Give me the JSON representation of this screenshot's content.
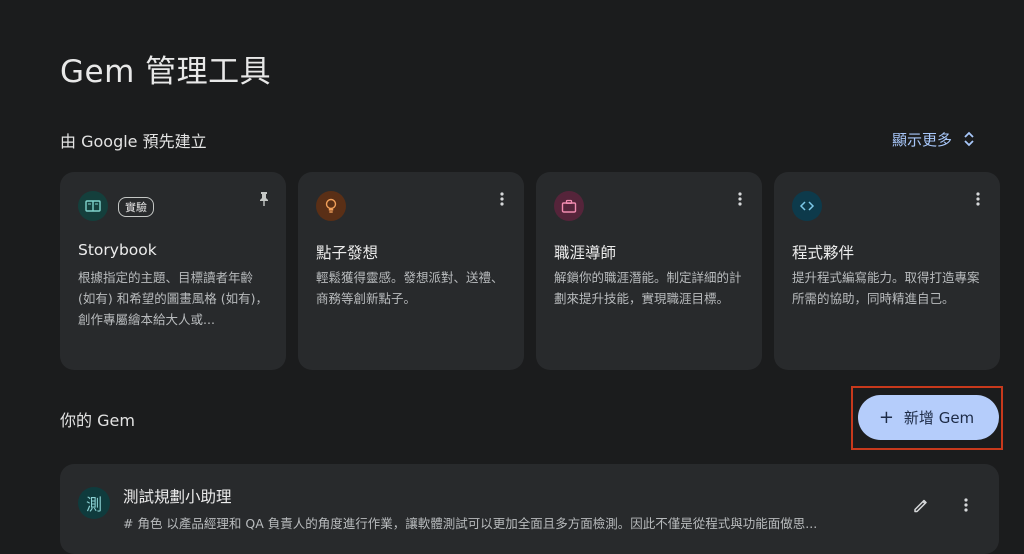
{
  "page": {
    "title": "Gem 管理工具"
  },
  "premade": {
    "title": "由 Google 預先建立",
    "show_more": "顯示更多",
    "cards": [
      {
        "title": "Storybook",
        "badge": "實驗",
        "description": "根據指定的主題、目標讀者年齡 (如有) 和希望的圖畫風格 (如有)，創作專屬繪本給大人或...",
        "icon": "book-icon",
        "corner_icon": "pin-icon",
        "color": "#143f3c"
      },
      {
        "title": "點子發想",
        "description": "輕鬆獲得靈感。發想派對、送禮、商務等創新點子。",
        "icon": "lightbulb-icon",
        "corner_icon": "more-vert-icon",
        "color": "#5a2f16"
      },
      {
        "title": "職涯導師",
        "description": "解鎖你的職涯潛能。制定詳細的計劃來提升技能，實現職涯目標。",
        "icon": "briefcase-icon",
        "corner_icon": "more-vert-icon",
        "color": "#55243a"
      },
      {
        "title": "程式夥伴",
        "description": "提升程式編寫能力。取得打造專案所需的協助，同時精進自己。",
        "icon": "code-icon",
        "corner_icon": "more-vert-icon",
        "color": "#0d3a4b"
      }
    ]
  },
  "your_gems": {
    "title": "你的 Gem",
    "new_button": "新增 Gem",
    "items": [
      {
        "avatar": "測",
        "name": "測試規劃小助理",
        "description": "# 角色 以產品經理和 QA 負責人的角度進行作業，讓軟體測試可以更加全面且多方面檢測。因此不僅是從程式與功能面做思..."
      }
    ]
  },
  "colors": {
    "background": "#1b1c1d",
    "card": "#282a2c",
    "accent": "#a8c7fa",
    "primary_button": "#b5cdfb",
    "highlight_box": "#c8391c"
  }
}
